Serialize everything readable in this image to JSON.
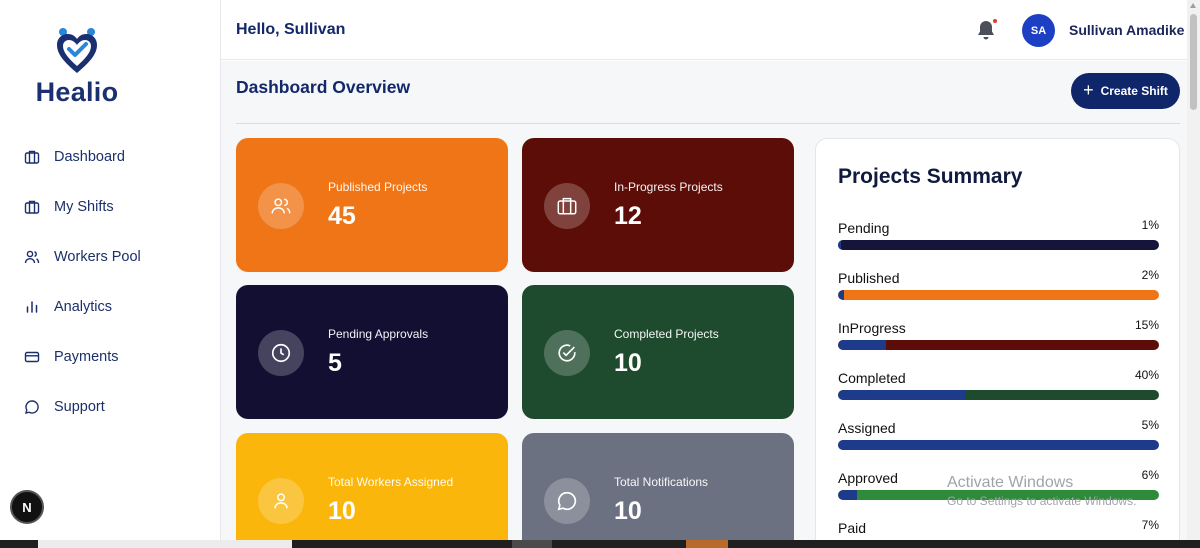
{
  "brand": {
    "name": "Healio"
  },
  "sidebar": {
    "items": [
      {
        "label": "Dashboard",
        "icon": "briefcase-icon"
      },
      {
        "label": "My Shifts",
        "icon": "briefcase-icon"
      },
      {
        "label": "Workers Pool",
        "icon": "users-icon"
      },
      {
        "label": "Analytics",
        "icon": "bar-chart-icon"
      },
      {
        "label": "Payments",
        "icon": "credit-card-icon"
      },
      {
        "label": "Support",
        "icon": "chat-bubble-icon"
      }
    ],
    "badge": "N"
  },
  "header": {
    "greeting": "Hello, Sullivan",
    "avatar_initials": "SA",
    "user_name": "Sullivan Amadike"
  },
  "main": {
    "title": "Dashboard Overview",
    "create_button": "Create Shift",
    "cards": [
      {
        "label": "Published Projects",
        "value": "45",
        "color": "#f07516",
        "icon": "users-icon"
      },
      {
        "label": "In-Progress Projects",
        "value": "12",
        "color": "#5c0d07",
        "icon": "briefcase-icon"
      },
      {
        "label": "Pending Approvals",
        "value": "5",
        "color": "#130f33",
        "icon": "clock-icon"
      },
      {
        "label": "Completed Projects",
        "value": "10",
        "color": "#1e4a2d",
        "icon": "check-circle-icon"
      },
      {
        "label": "Total Workers Assigned",
        "value": "10",
        "color": "#fab60a",
        "icon": "user-icon"
      },
      {
        "label": "Total Notifications",
        "value": "10",
        "color": "#6b7180",
        "icon": "chat-bubble-icon"
      }
    ]
  },
  "summary": {
    "title": "Projects Summary",
    "rows": [
      {
        "label": "Pending",
        "percent": "1%",
        "value": 1,
        "track_color": "#15143a"
      },
      {
        "label": "Published",
        "percent": "2%",
        "value": 2,
        "track_color": "#f07516"
      },
      {
        "label": "InProgress",
        "percent": "15%",
        "value": 15,
        "track_color": "#5c0d07"
      },
      {
        "label": "Completed",
        "percent": "40%",
        "value": 40,
        "track_color": "#1e4a2d"
      },
      {
        "label": "Assigned",
        "percent": "5%",
        "value": 5,
        "track_color": "#1e3a8a"
      },
      {
        "label": "Approved",
        "percent": "6%",
        "value": 6,
        "track_color": "#2e8b3a"
      },
      {
        "label": "Paid",
        "percent": "7%",
        "value": 7,
        "track_color": "#1e3a8a"
      }
    ]
  },
  "watermark": {
    "line1": "Activate Windows",
    "line2": "Go to Settings to activate Windows."
  }
}
